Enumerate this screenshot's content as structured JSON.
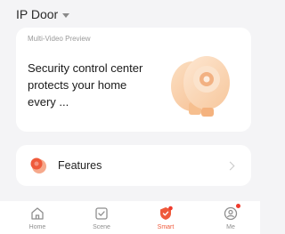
{
  "header": {
    "home_name": "IP Door"
  },
  "preview": {
    "label": "Multi-Video Preview",
    "message": "Security control center protects your home every ..."
  },
  "features": {
    "label": "Features"
  },
  "tabbar": {
    "items": [
      {
        "label": "Home",
        "icon": "home-icon",
        "active": false
      },
      {
        "label": "Scene",
        "icon": "scene-icon",
        "active": false
      },
      {
        "label": "Smart",
        "icon": "smart-icon",
        "active": true
      },
      {
        "label": "Me",
        "icon": "me-icon",
        "active": false,
        "badge": true
      }
    ]
  },
  "colors": {
    "accent": "#ef5a3b",
    "background": "#f4f4f6",
    "card": "#ffffff",
    "badge": "#ef3b2d"
  }
}
